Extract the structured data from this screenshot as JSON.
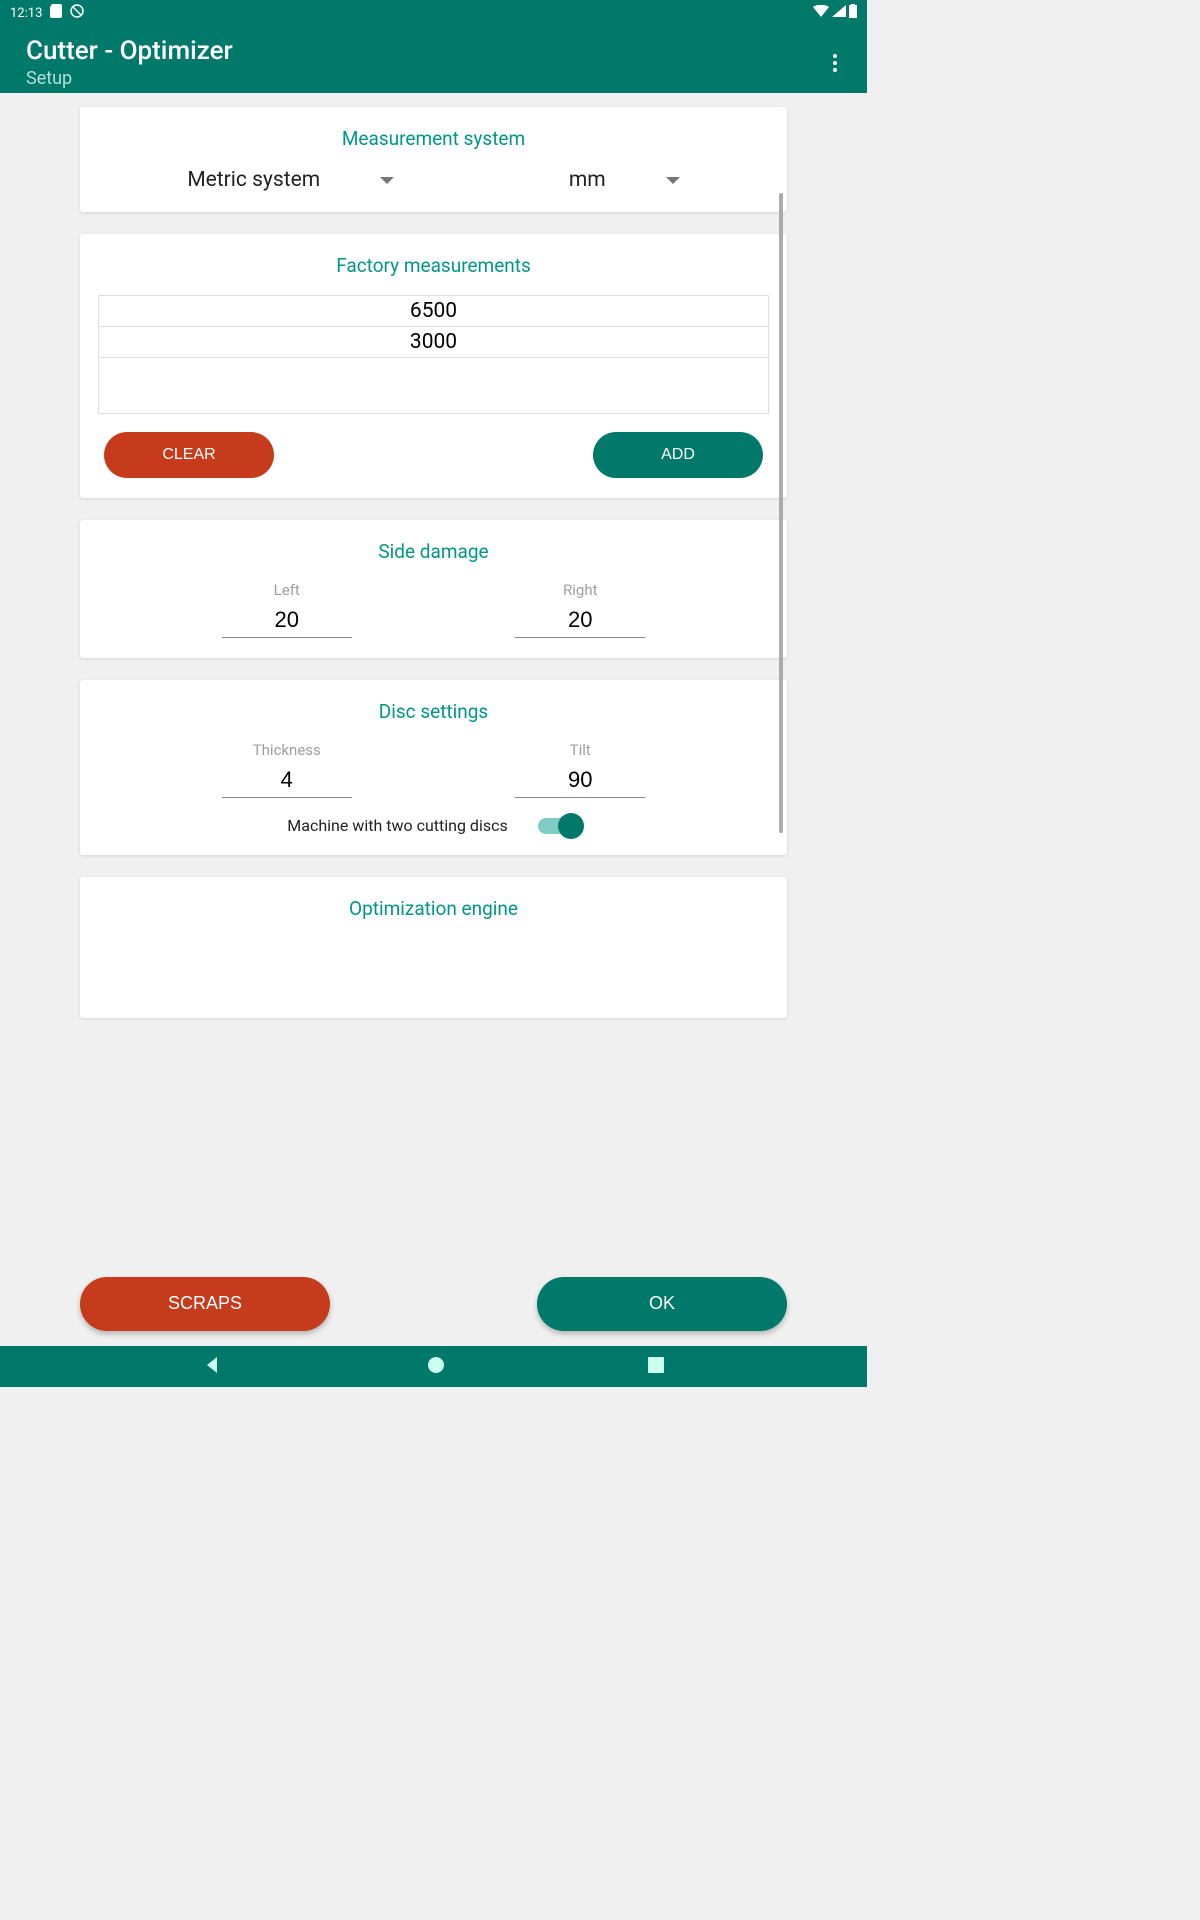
{
  "status": {
    "time": "12:13"
  },
  "appbar": {
    "title": "Cutter - Optimizer",
    "subtitle": "Setup"
  },
  "measurement": {
    "title": "Measurement system",
    "system": "Metric system",
    "unit": "mm"
  },
  "factory": {
    "title": "Factory measurements",
    "rows": [
      "6500",
      "3000"
    ],
    "clear": "CLEAR",
    "add": "ADD"
  },
  "side_damage": {
    "title": "Side damage",
    "left_label": "Left",
    "left_value": "20",
    "right_label": "Right",
    "right_value": "20"
  },
  "disc": {
    "title": "Disc settings",
    "thickness_label": "Thickness",
    "thickness_value": "4",
    "tilt_label": "Tilt",
    "tilt_value": "90",
    "two_disc_label": "Machine with two cutting discs",
    "two_disc_on": true
  },
  "optimization": {
    "title": "Optimization engine"
  },
  "bottom": {
    "scraps": "SCRAPS",
    "ok": "OK"
  }
}
